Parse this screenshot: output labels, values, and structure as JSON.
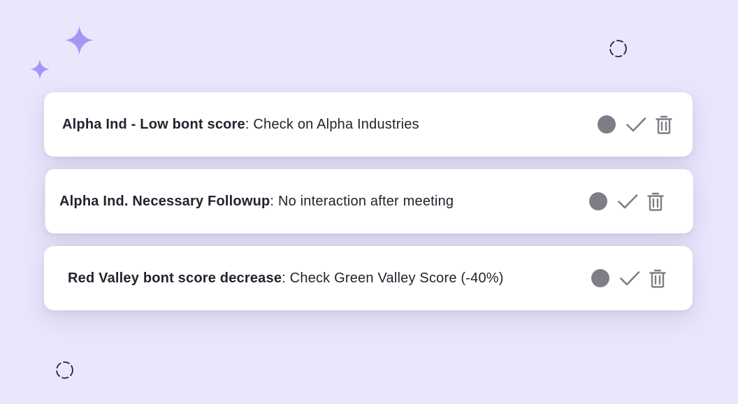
{
  "colors": {
    "background": "#ebe6fc",
    "card": "#ffffff",
    "sparkle": "#a795f6",
    "icon": "#7e7e86",
    "text": "#23232e"
  },
  "decorations": [
    "sparkle-icon",
    "sparkle-icon",
    "loading-spinner-icon",
    "loading-spinner-icon"
  ],
  "tasks": [
    {
      "title": "Alpha Ind - Low bont score",
      "separator": ": ",
      "description": "Check on Alpha Industries",
      "actions": [
        "status-dot",
        "check-icon",
        "trash-icon"
      ]
    },
    {
      "title": "Alpha Ind. Necessary Followup",
      "separator": ": ",
      "description": "No interaction after meeting",
      "actions": [
        "status-dot",
        "check-icon",
        "trash-icon"
      ]
    },
    {
      "title": "Red Valley bont score decrease",
      "separator": ": ",
      "description": "Check Green Valley Score (-40%)",
      "actions": [
        "status-dot",
        "check-icon",
        "trash-icon"
      ]
    }
  ]
}
